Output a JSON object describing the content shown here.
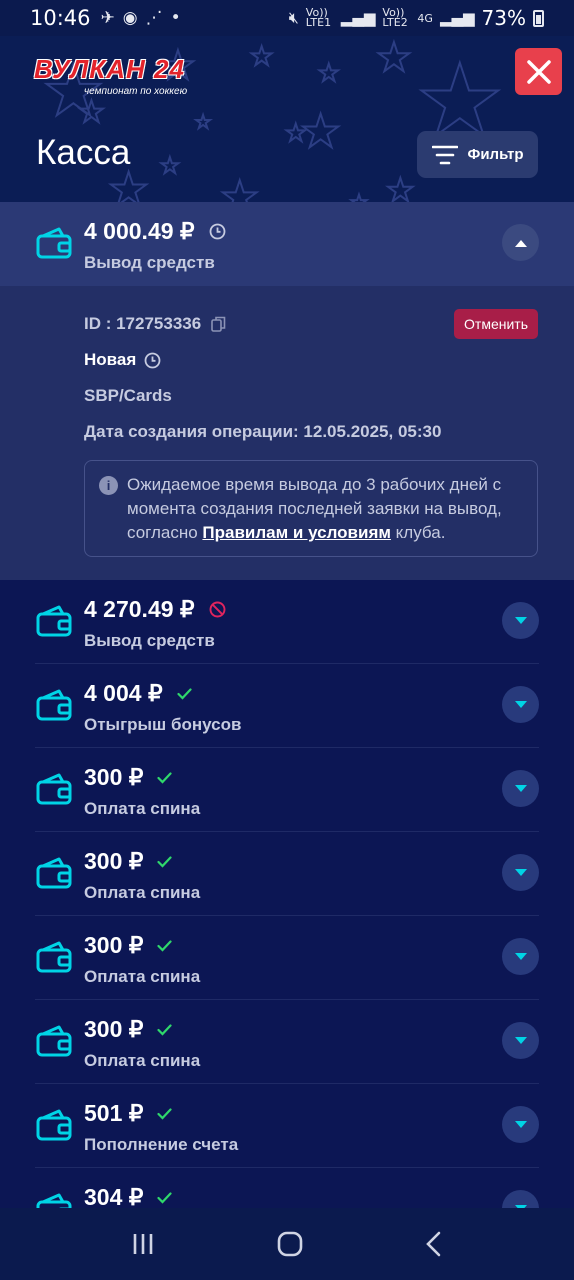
{
  "status_bar": {
    "time": "10:46",
    "battery": "73%",
    "sim1": "Vo)) LTE1",
    "sim2": "Vo)) LTE2",
    "network": "4G"
  },
  "header": {
    "logo_text": "ВУЛКАН 24",
    "logo_sub": "чемпионат по хоккею",
    "title": "Касса",
    "filter_label": "Фильтр"
  },
  "expanded": {
    "amount": "4 000.49 ₽",
    "type": "Вывод средств",
    "id_label": "ID : 172753336",
    "cancel_label": "Отменить",
    "status": "Новая",
    "method": "SBP/Cards",
    "date": "Дата создания операции: 12.05.2025, 05:30",
    "info_pre": "Ожидаемое время вывода до 3 рабочих дней с момента создания последней заявки на вывод, согласно ",
    "info_link": "Правилам и условиям",
    "info_post": " клуба."
  },
  "transactions": [
    {
      "amount": "4 270.49 ₽",
      "type": "Вывод средств",
      "status_icon": "cancelled-icon"
    },
    {
      "amount": "4 004 ₽",
      "type": "Отыгрыш бонусов",
      "status_icon": "check-icon"
    },
    {
      "amount": "300 ₽",
      "type": "Оплата спина",
      "status_icon": "check-icon"
    },
    {
      "amount": "300 ₽",
      "type": "Оплата спина",
      "status_icon": "check-icon"
    },
    {
      "amount": "300 ₽",
      "type": "Оплата спина",
      "status_icon": "check-icon"
    },
    {
      "amount": "300 ₽",
      "type": "Оплата спина",
      "status_icon": "check-icon"
    },
    {
      "amount": "501 ₽",
      "type": "Пополнение счета",
      "status_icon": "check-icon"
    },
    {
      "amount": "304 ₽",
      "type": "",
      "status_icon": "check-icon"
    }
  ],
  "colors": {
    "background": "#0c1654",
    "accent": "#00d4e6",
    "check": "#2fd86b",
    "cancel": "#e0245e",
    "close": "#e8404c"
  }
}
